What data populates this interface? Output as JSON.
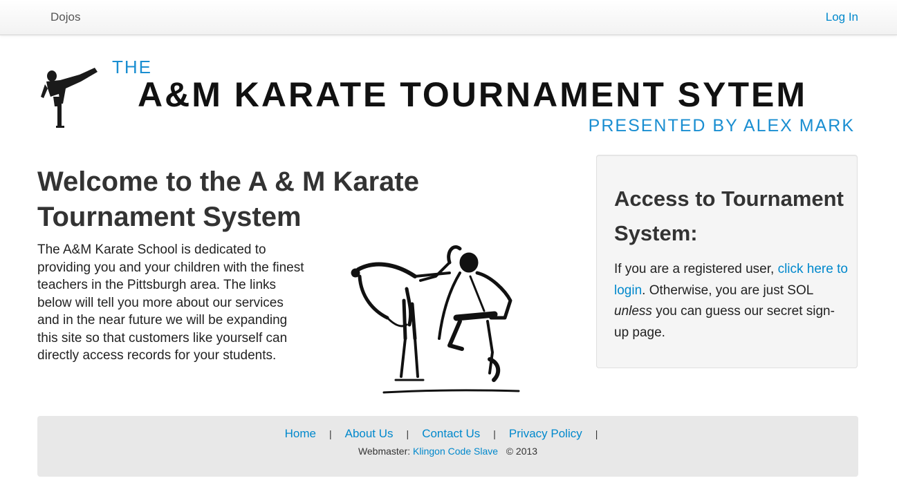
{
  "navbar": {
    "brand": "Dojos",
    "login": "Log In"
  },
  "banner": {
    "the": "THE",
    "title": "A&M KARATE TOURNAMENT SYTEM",
    "presented_by": "PRESENTED BY ALEX MARK"
  },
  "welcome": {
    "heading": "Welcome to the A & M Karate Tournament System",
    "paragraph": "The A&M Karate School is dedicated to providing you and your children with the finest teachers in the Pittsburgh area. The links below will tell you more about our services and in the near future we will be expanding this site so that customers like yourself can directly access records for your students."
  },
  "access": {
    "heading": "Access to Tournament System:",
    "text_before_link": "If you are a registered user, ",
    "link": "click here to login",
    "text_after_link": ". Otherwise, you are just SOL ",
    "emphasis": "unless",
    "text_end": " you can guess our secret sign-up page."
  },
  "footer": {
    "links": [
      "Home",
      "About Us",
      "Contact Us",
      "Privacy Policy"
    ],
    "separator": "|",
    "webmaster_label": "Webmaster: ",
    "webmaster_name": "Klingon Code Slave",
    "copyright": "© 2013"
  },
  "colors": {
    "link": "#0088cc",
    "banner_accent": "#1a8ed1",
    "well_bg": "#f5f5f5",
    "footer_bg": "#e8e8e8"
  }
}
